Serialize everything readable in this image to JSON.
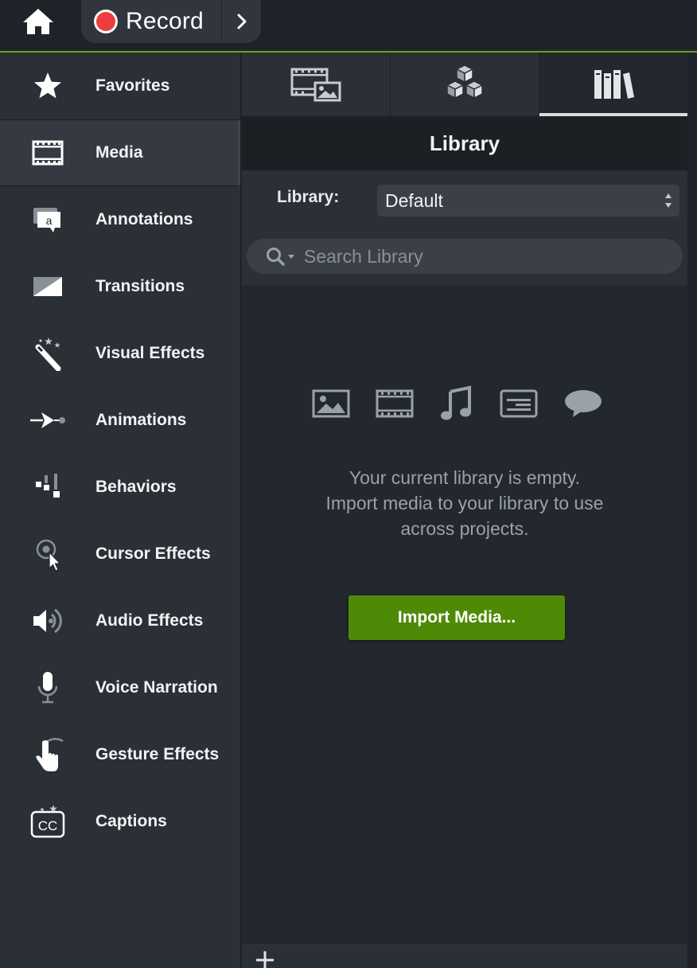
{
  "toolbar": {
    "home_icon": "home-icon",
    "record_label": "Record",
    "record_color": "#ef3d3d",
    "accent_color": "#6ca021"
  },
  "sidebar": {
    "items": [
      {
        "label": "Favorites",
        "icon": "star-icon"
      },
      {
        "label": "Media",
        "icon": "film-strip-icon",
        "active": true
      },
      {
        "label": "Annotations",
        "icon": "annotation-callout-icon"
      },
      {
        "label": "Transitions",
        "icon": "transition-icon"
      },
      {
        "label": "Visual Effects",
        "icon": "magic-wand-icon"
      },
      {
        "label": "Animations",
        "icon": "animation-arrow-icon"
      },
      {
        "label": "Behaviors",
        "icon": "behaviors-icon"
      },
      {
        "label": "Cursor Effects",
        "icon": "cursor-icon"
      },
      {
        "label": "Audio Effects",
        "icon": "speaker-icon"
      },
      {
        "label": "Voice Narration",
        "icon": "microphone-icon"
      },
      {
        "label": "Gesture Effects",
        "icon": "hand-gesture-icon"
      },
      {
        "label": "Captions",
        "icon": "closed-captions-icon"
      }
    ],
    "captions_icon_text": "CC",
    "annotation_icon_text": "a"
  },
  "tabs": [
    {
      "name": "media-bin",
      "icon": "media-bin-icon"
    },
    {
      "name": "library-assets",
      "icon": "cubes-icon"
    },
    {
      "name": "library",
      "icon": "books-icon",
      "active": true
    }
  ],
  "panel": {
    "title": "Library",
    "library_label": "Library:",
    "library_select_value": "Default",
    "search_placeholder": "Search Library",
    "empty_line1": "Your current library is empty.",
    "empty_line2": "Import media to your library to use",
    "empty_line3": "across projects.",
    "import_button": "Import Media...",
    "import_button_color": "#4f8a07",
    "media_type_icons": [
      "image-icon",
      "video-icon",
      "music-note-icon",
      "text-caption-icon",
      "speech-bubble-icon"
    ]
  }
}
